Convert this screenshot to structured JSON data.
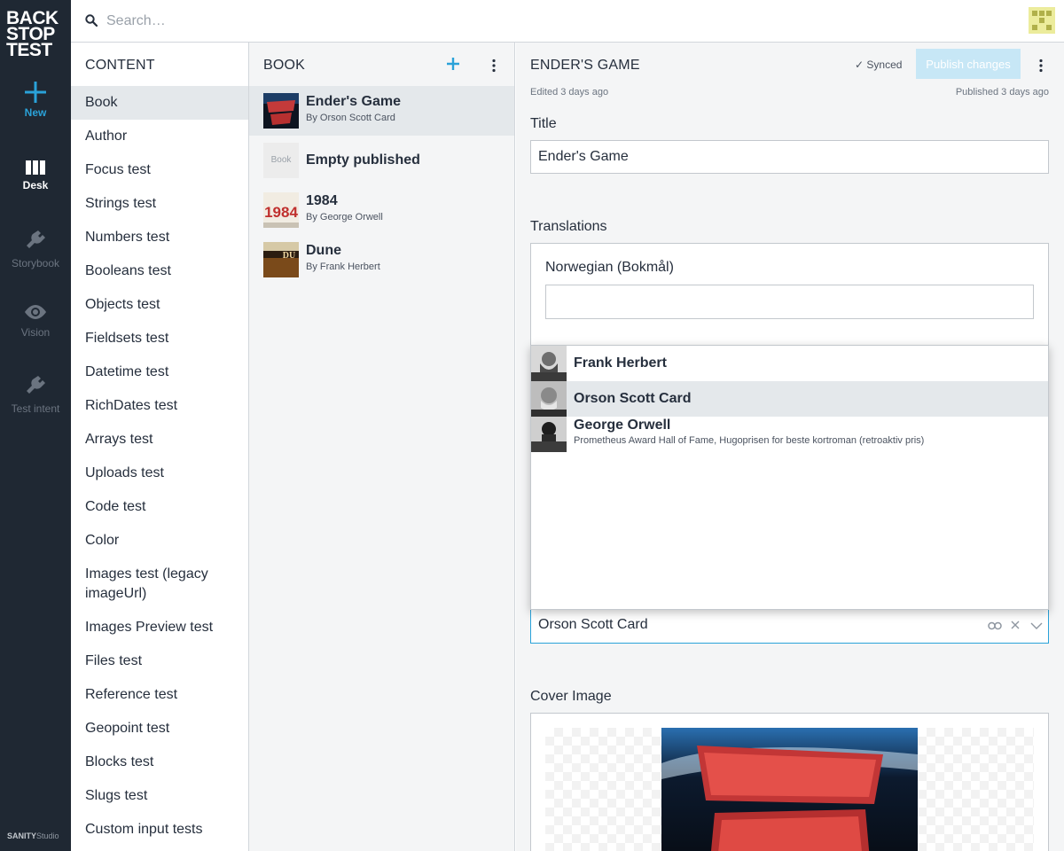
{
  "brand": {
    "logo_lines": [
      "BACK",
      "STOP",
      "TEST"
    ],
    "footer_bold": "SANITY",
    "footer_light": "Studio"
  },
  "rail": {
    "items": [
      {
        "label": "New",
        "icon": "plus-icon"
      },
      {
        "label": "Desk",
        "icon": "columns-icon"
      },
      {
        "label": "Storybook",
        "icon": "plug-icon"
      },
      {
        "label": "Vision",
        "icon": "eye-icon"
      },
      {
        "label": "Test intent",
        "icon": "plug-icon"
      }
    ]
  },
  "search": {
    "placeholder": "Search…"
  },
  "content_pane": {
    "title": "CONTENT",
    "items": [
      "Book",
      "Author",
      "Focus test",
      "Strings test",
      "Numbers test",
      "Booleans test",
      "Objects test",
      "Fieldsets test",
      "Datetime test",
      "RichDates test",
      "Arrays test",
      "Uploads test",
      "Code test",
      "Color",
      "Images test (legacy imageUrl)",
      "Images Preview test",
      "Files test",
      "Reference test",
      "Geopoint test",
      "Blocks test",
      "Slugs test",
      "Custom input tests"
    ]
  },
  "book_pane": {
    "title": "BOOK",
    "items": [
      {
        "title": "Ender's Game",
        "subtitle": "By Orson Scott Card"
      },
      {
        "title": "Empty published",
        "subtitle": "",
        "placeholder": "Book"
      },
      {
        "title": "1984",
        "subtitle": "By George Orwell",
        "cover_text": "1984"
      },
      {
        "title": "Dune",
        "subtitle": "By Frank Herbert",
        "cover_text": "DU"
      }
    ]
  },
  "editor": {
    "title": "ENDER'S GAME",
    "status": "✓ Synced",
    "publish_label": "Publish changes",
    "edited": "Edited 3 days ago",
    "published": "Published 3 days ago",
    "title_label": "Title",
    "title_value": "Ender's Game",
    "translations_label": "Translations",
    "translation_lang": "Norwegian (Bokmål)",
    "author_value": "Orson Scott Card",
    "cover_label": "Cover Image"
  },
  "dropdown": {
    "items": [
      {
        "name": "Frank Herbert",
        "sub": ""
      },
      {
        "name": "Orson Scott Card",
        "sub": ""
      },
      {
        "name": "George Orwell",
        "sub": "Prometheus Award Hall of Fame, Hugoprisen for beste kortroman (retroaktiv pris)"
      }
    ]
  },
  "colors": {
    "accent": "#2aa2d9",
    "rail": "#1f2833",
    "publish_disabled": "#c7e7f6"
  }
}
